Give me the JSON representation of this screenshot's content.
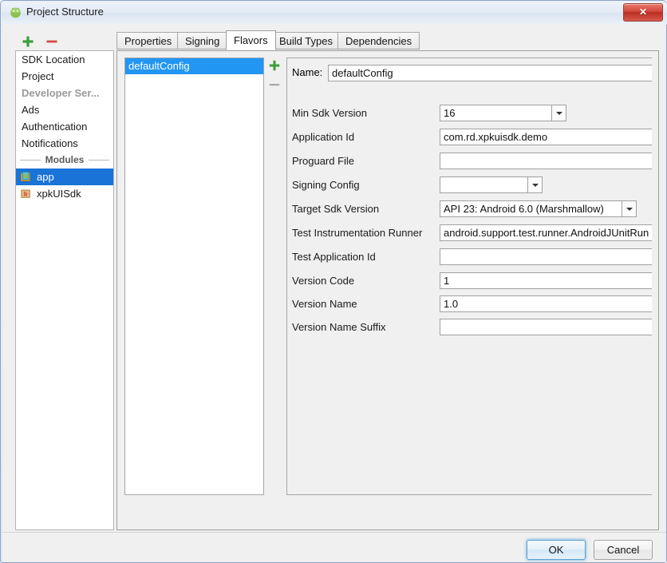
{
  "window": {
    "title": "Project Structure",
    "icon": "android-studio-icon",
    "close_label": "✕"
  },
  "sidebar": {
    "toolbar": {
      "add_label": "+",
      "remove_label": "−",
      "add_icon": "plus-icon",
      "remove_icon": "minus-icon"
    },
    "items": [
      {
        "label": "SDK Location",
        "type": "item",
        "selected": false
      },
      {
        "label": "Project",
        "type": "item",
        "selected": false
      },
      {
        "label": "Developer Ser...",
        "type": "header",
        "selected": false
      },
      {
        "label": "Ads",
        "type": "item",
        "selected": false
      },
      {
        "label": "Authentication",
        "type": "item",
        "selected": false
      },
      {
        "label": "Notifications",
        "type": "item",
        "selected": false
      }
    ],
    "modules_separator": "Modules",
    "modules": [
      {
        "label": "app",
        "icon": "android-module-icon",
        "selected": true
      },
      {
        "label": "xpkUISdk",
        "icon": "library-module-icon",
        "selected": false
      }
    ]
  },
  "tabs": [
    {
      "label": "Properties",
      "active": false
    },
    {
      "label": "Signing",
      "active": false
    },
    {
      "label": "Flavors",
      "active": true
    },
    {
      "label": "Build Types",
      "active": false
    },
    {
      "label": "Dependencies",
      "active": false
    }
  ],
  "flavors": {
    "items": [
      {
        "label": "defaultConfig",
        "selected": true
      }
    ],
    "add_label": "+",
    "remove_label": "−"
  },
  "form": {
    "name_label": "Name:",
    "name_value": "defaultConfig",
    "rows": [
      {
        "label": "Min Sdk Version",
        "value": "16",
        "control": "combo",
        "field_width": 140
      },
      {
        "label": "Application Id",
        "value": "com.rd.xpkuisdk.demo",
        "control": "text",
        "field_width": 270
      },
      {
        "label": "Proguard File",
        "value": "",
        "control": "text",
        "field_width": 270
      },
      {
        "label": "Signing Config",
        "value": "",
        "control": "combo",
        "field_width": 110
      },
      {
        "label": "Target Sdk Version",
        "value": "API 23: Android 6.0 (Marshmallow)",
        "control": "combo",
        "field_width": 224
      },
      {
        "label": "Test Instrumentation Runner",
        "value": "android.support.test.runner.AndroidJUnitRunner",
        "control": "text",
        "field_width": 270
      },
      {
        "label": "Test Application Id",
        "value": "",
        "control": "text",
        "field_width": 270
      },
      {
        "label": "Version Code",
        "value": "1",
        "control": "text",
        "field_width": 270
      },
      {
        "label": "Version Name",
        "value": "1.0",
        "control": "text",
        "field_width": 270
      },
      {
        "label": "Version Name Suffix",
        "value": "",
        "control": "text",
        "field_width": 270
      }
    ]
  },
  "footer": {
    "ok_label": "OK",
    "cancel_label": "Cancel"
  },
  "colors": {
    "selection_blue": "#1a73d6",
    "flavor_selection_blue": "#2196f3",
    "close_red": "#c0392b",
    "plus_green": "#36a832",
    "minus_red": "#cf4b42",
    "header_grey": "#9a9a9a",
    "dialog_bg": "#f0f0f0"
  }
}
